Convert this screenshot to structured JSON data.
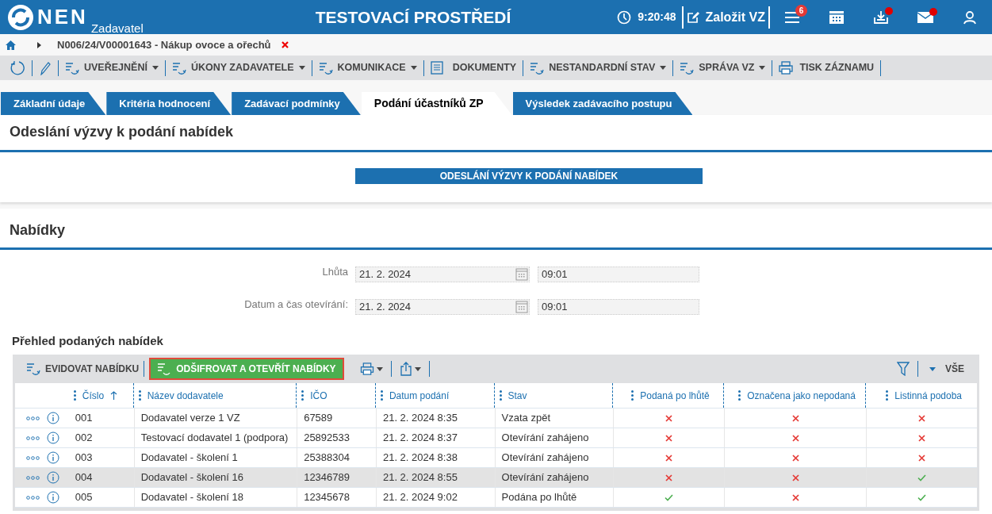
{
  "header": {
    "logo": "NEN",
    "logo_subtitle": "Zadavatel",
    "title": "TESTOVACÍ PROSTŘEDÍ",
    "time": "9:20:48",
    "create_button": "Založit VZ",
    "icons": [
      {
        "kind": "menu",
        "badge": "6",
        "dot": false
      },
      {
        "kind": "calendar",
        "dot": false
      },
      {
        "kind": "inbox",
        "dot": true
      },
      {
        "kind": "mail",
        "dot": true
      },
      {
        "kind": "user",
        "dot": false
      }
    ]
  },
  "breadcrumb": {
    "item": "N006/24/V00001643 - Nákup ovoce a ořechů"
  },
  "toolbar": [
    {
      "kind": "refresh"
    },
    {
      "kind": "edit"
    },
    {
      "kind": "menu",
      "label": "UVEŘEJNĚNÍ"
    },
    {
      "kind": "menu",
      "label": "ÚKONY ZADAVATELE"
    },
    {
      "kind": "menu",
      "label": "KOMUNIKACE"
    },
    {
      "kind": "doc",
      "label": "DOKUMENTY"
    },
    {
      "kind": "menu",
      "label": "NESTANDARDNÍ STAV"
    },
    {
      "kind": "menu",
      "label": "SPRÁVA VZ"
    },
    {
      "kind": "print",
      "label": "TISK ZÁZNAMU"
    }
  ],
  "tabs": [
    {
      "label": "Základní údaje",
      "selected": false
    },
    {
      "label": "Kritéria hodnocení",
      "selected": false
    },
    {
      "label": "Zadávací podmínky",
      "selected": false
    },
    {
      "label": "Podání účastníků ZP",
      "selected": true
    },
    {
      "label": "Výsledek zadávacího postupu",
      "selected": false
    }
  ],
  "section_invite": {
    "title": "Odeslání výzvy k podání nabídek",
    "button": "ODESLÁNÍ VÝZVY K PODÁNÍ NABÍDEK"
  },
  "section_offers": {
    "title": "Nabídky",
    "fields": [
      {
        "label": "Lhůta",
        "date": "21. 2. 2024",
        "time": "09:01"
      },
      {
        "label": "Datum a čas otevírání:",
        "date": "21. 2. 2024",
        "time": "09:01"
      }
    ],
    "subtitle": "Přehled podaných nabídek",
    "grid_toolbar": {
      "register": "EVIDOVAT NABÍDKU",
      "open": "ODŠIFROVAT A OTEVŘÍT NABÍDKY",
      "filter_all": "VŠE"
    },
    "table": {
      "columns": [
        "Číslo",
        "Název dodavatele",
        "IČO",
        "Datum podání",
        "Stav",
        "Podaná po lhůtě",
        "Označena jako nepodaná",
        "Listinná podoba"
      ],
      "rows": [
        {
          "number": "001",
          "supplier": "Dodavatel verze 1 VZ",
          "ico": "67589",
          "date": "21. 2. 2024 8:35",
          "status": "Vzata zpět",
          "late": false,
          "not_submitted": false,
          "paper": false,
          "selected": false
        },
        {
          "number": "002",
          "supplier": "Testovací dodavatel 1 (podpora)",
          "ico": "25892533",
          "date": "21. 2. 2024 8:37",
          "status": "Otevírání zahájeno",
          "late": false,
          "not_submitted": false,
          "paper": false,
          "selected": false
        },
        {
          "number": "003",
          "supplier": "Dodavatel - školení 1",
          "ico": "25388304",
          "date": "21. 2. 2024 8:38",
          "status": "Otevírání zahájeno",
          "late": false,
          "not_submitted": false,
          "paper": false,
          "selected": false
        },
        {
          "number": "004",
          "supplier": "Dodavatel - školení 16",
          "ico": "12346789",
          "date": "21. 2. 2024 8:55",
          "status": "Otevírání zahájeno",
          "late": false,
          "not_submitted": false,
          "paper": true,
          "selected": true
        },
        {
          "number": "005",
          "supplier": "Dodavatel - školení 18",
          "ico": "12345678",
          "date": "21. 2. 2024 9:02",
          "status": "Podána po lhůtě",
          "late": true,
          "not_submitted": false,
          "paper": true,
          "selected": false
        }
      ]
    }
  }
}
